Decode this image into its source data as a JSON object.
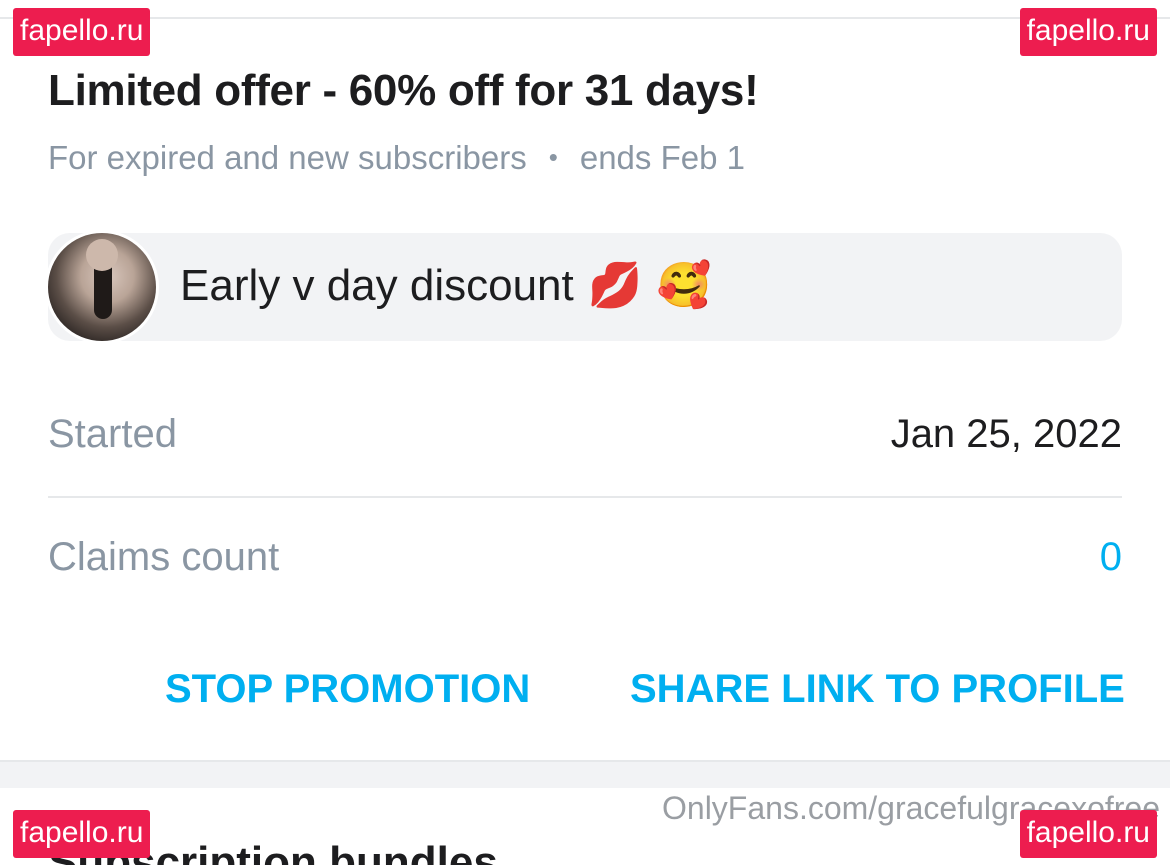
{
  "offer": {
    "title": "Limited offer - 60% off for 31 days!",
    "audience": "For expired and new subscribers",
    "separator": "•",
    "ends": "ends Feb 1"
  },
  "message": {
    "text": "Early v day discount",
    "emoji_1": "💋",
    "emoji_2": "🥰"
  },
  "details": {
    "started_label": "Started",
    "started_value": "Jan 25, 2022",
    "claims_label": "Claims count",
    "claims_value": "0"
  },
  "actions": {
    "stop_label": "STOP PROMOTION",
    "share_label": "SHARE LINK TO PROFILE"
  },
  "next_section": {
    "title": "Subscription bundles"
  },
  "watermarks": {
    "site": "fapello.ru",
    "profile_url": "OnlyFans.com/gracefulgracexofree"
  },
  "colors": {
    "accent": "#00aff0",
    "badge": "#ed1d4f",
    "muted_text": "#8a96a3"
  }
}
